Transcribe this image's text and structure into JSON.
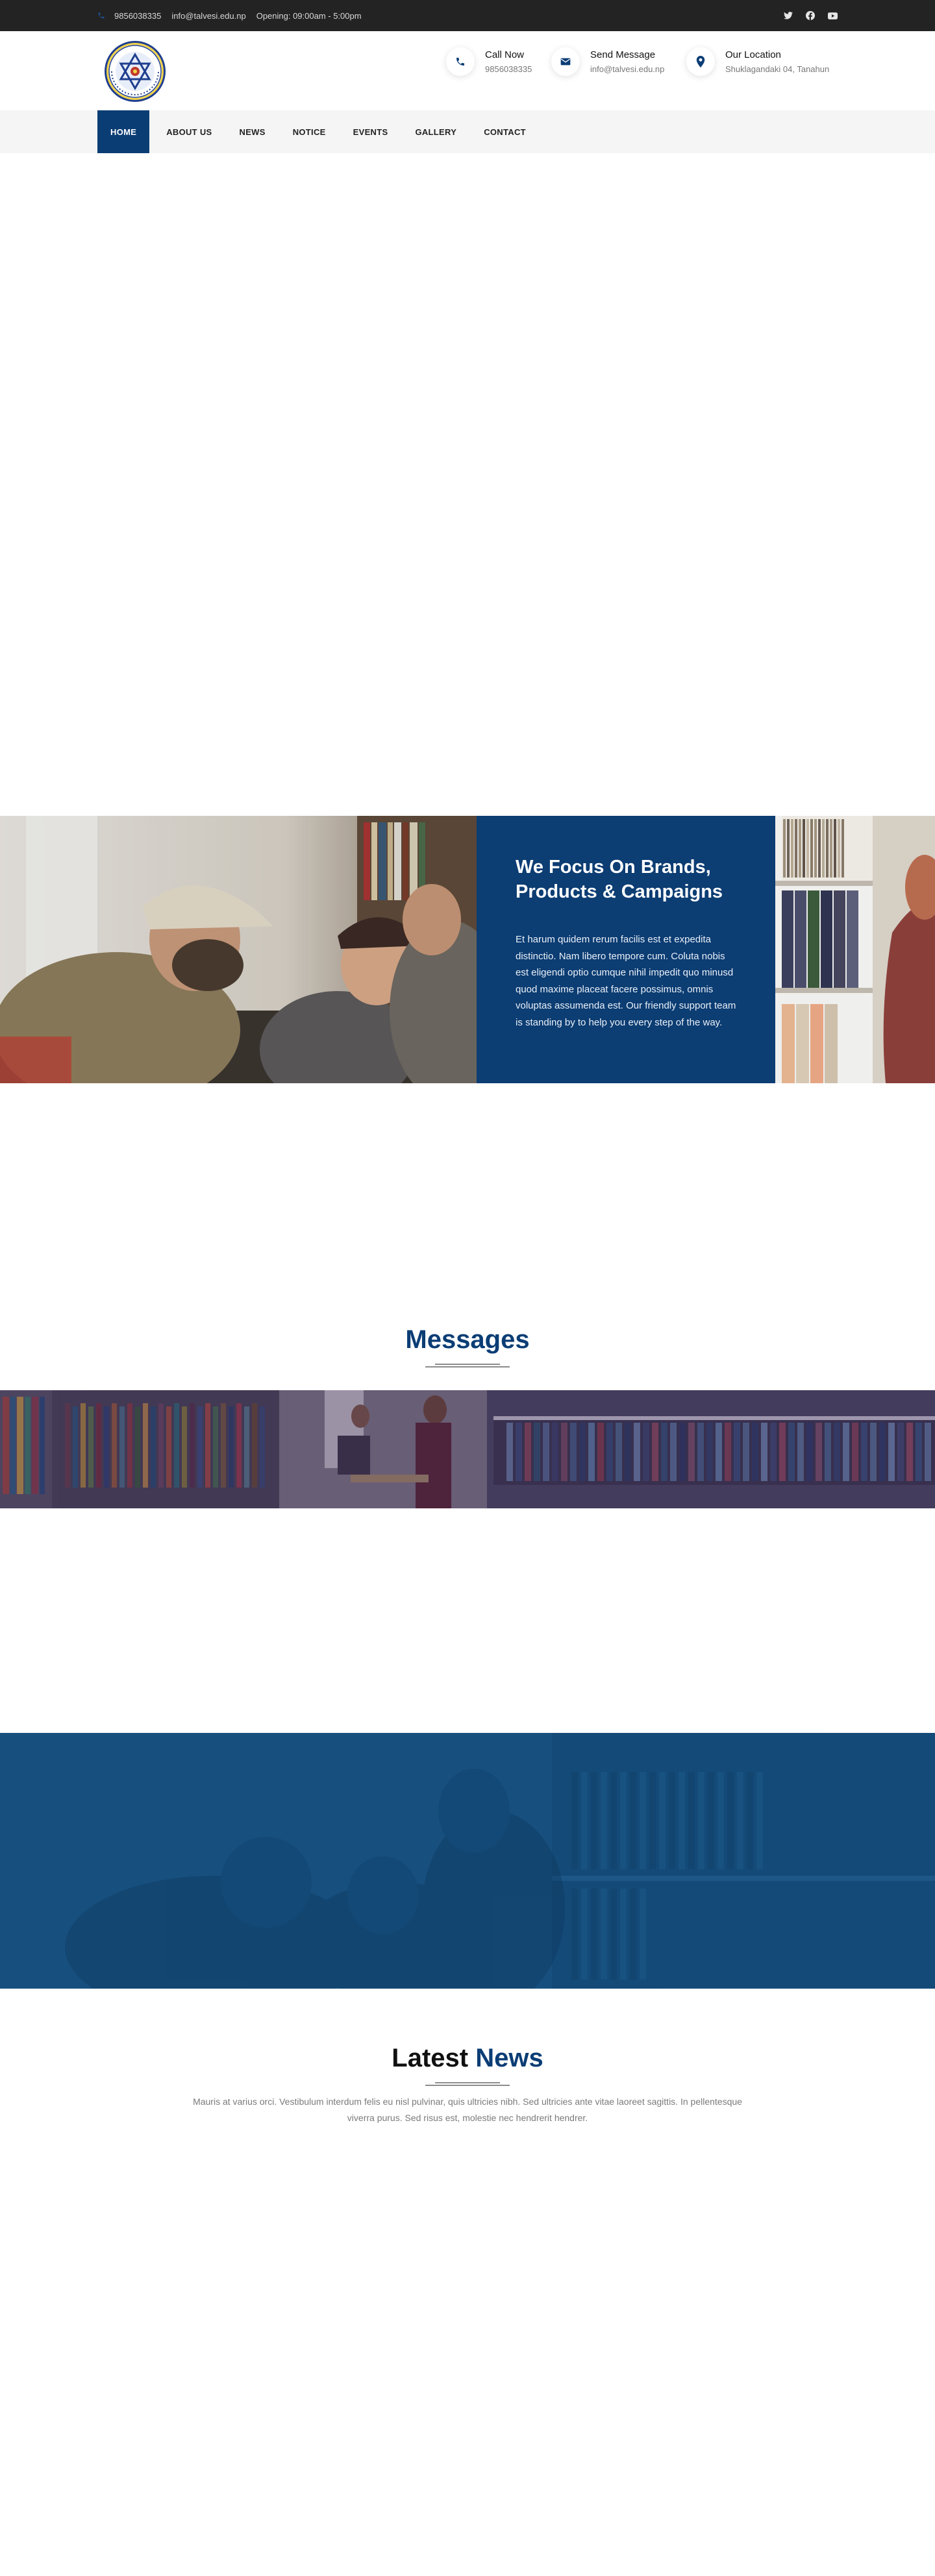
{
  "topbar": {
    "phone": "9856038335",
    "email": "info@talvesi.edu.np",
    "opening": "Opening: 09:00am - 5:00pm",
    "social_icons": [
      "twitter-icon",
      "facebook-icon",
      "youtube-icon"
    ]
  },
  "header": {
    "contacts": [
      {
        "title": "Call Now",
        "value": "9856038335",
        "icon": "phone-icon"
      },
      {
        "title": "Send Message",
        "value": "info@talvesi.edu.np",
        "icon": "envelope-icon"
      },
      {
        "title": "Our Location",
        "value": "Shuklagandaki 04, Tanahun",
        "icon": "map-pin-icon"
      }
    ]
  },
  "nav": {
    "items": [
      "HOME",
      "ABOUT US",
      "NEWS",
      "NOTICE",
      "EVENTS",
      "GALLERY",
      "CONTACT"
    ],
    "active": "HOME"
  },
  "feature": {
    "title": "We Focus On Brands, Products & Campaigns",
    "text": "Et harum quidem rerum facilis est et expedita distinctio. Nam libero tempore cum. Coluta nobis est eligendi optio cumque nihil impedit quo minusd quod maxime placeat facere possimus, omnis voluptas assumenda est. Our friendly support team is standing by to help you every step of the way."
  },
  "messages": {
    "title": "Messages"
  },
  "news": {
    "title_a": "Latest",
    "title_b": "News",
    "description": "Mauris at varius orci. Vestibulum interdum felis eu nisl pulvinar, quis ultricies nibh. Sed ultricies ante vitae laoreet sagittis. In pellentesque viverra purus. Sed risus est, molestie nec hendrerit hendrer."
  },
  "colors": {
    "brand_blue": "#0b3d75",
    "topbar": "#232323",
    "nav_bg": "#f5f5f5"
  }
}
